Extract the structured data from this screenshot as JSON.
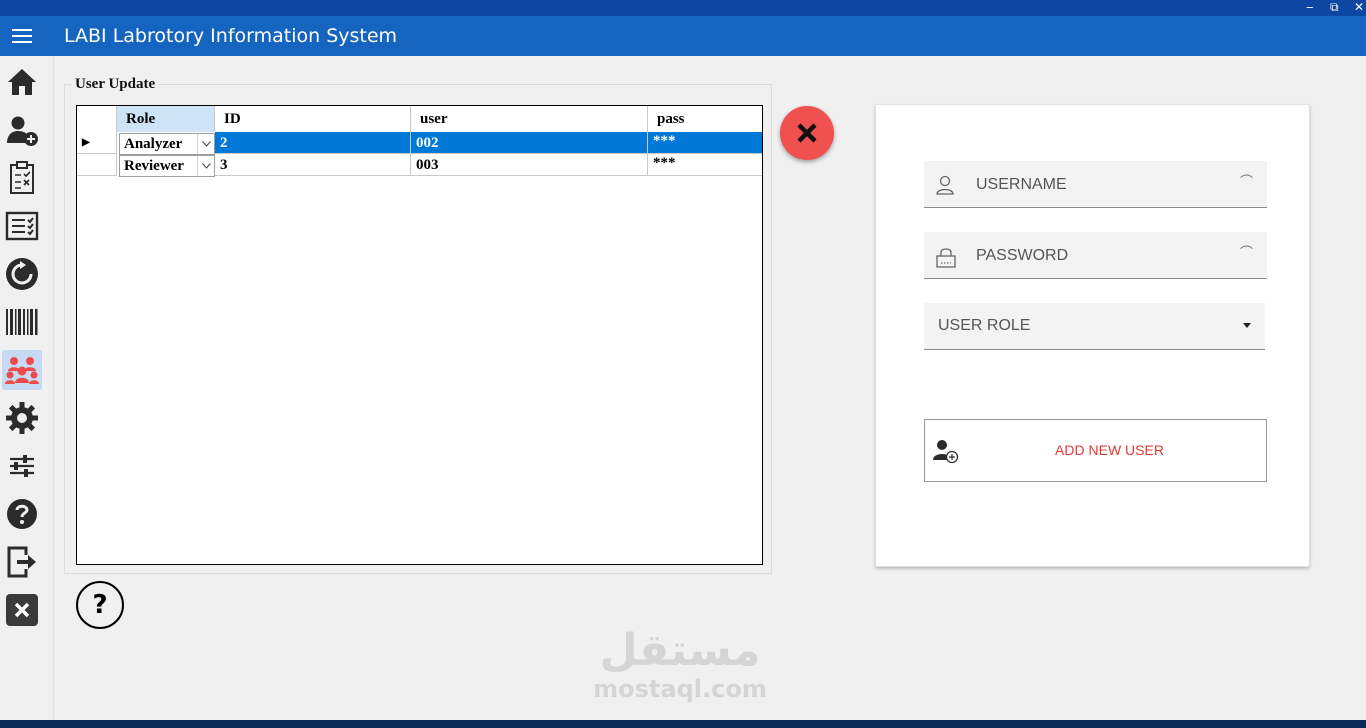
{
  "window": {
    "minimize_label": "‒",
    "restore_label": "⧉",
    "close_label": "✕"
  },
  "app": {
    "title": "LABI Labrotory Information System"
  },
  "sidebar": {
    "items": [
      {
        "name": "home-icon",
        "active": false
      },
      {
        "name": "add-patient-icon",
        "active": false
      },
      {
        "name": "test-checklist-icon",
        "active": false
      },
      {
        "name": "results-list-icon",
        "active": false
      },
      {
        "name": "refresh-icon",
        "active": false
      },
      {
        "name": "barcode-icon",
        "active": false
      },
      {
        "name": "users-group-icon",
        "active": true
      },
      {
        "name": "gear-icon",
        "active": false
      },
      {
        "name": "sliders-icon",
        "active": false
      },
      {
        "name": "help-icon",
        "active": false
      },
      {
        "name": "logout-icon",
        "active": false
      },
      {
        "name": "exit-icon",
        "active": false
      }
    ]
  },
  "user_update": {
    "title": "User Update",
    "columns": [
      "Role",
      "ID",
      "user",
      "pass"
    ],
    "rows": [
      {
        "role": "Analyzer",
        "id": "2",
        "user": "002",
        "pass": "***",
        "selected": true
      },
      {
        "role": "Reviewer",
        "id": "3",
        "user": "003",
        "pass": "***",
        "selected": false
      }
    ]
  },
  "form": {
    "username_placeholder": "USERNAME",
    "password_placeholder": "PASSWORD",
    "user_role_label": "USER ROLE",
    "add_button_label": "ADD NEW USER"
  },
  "watermark": {
    "arabic": "مستقل",
    "latin": "mostaql.com"
  },
  "colors": {
    "appbar": "#1565c0",
    "selection": "#0078d7",
    "danger": "#f05050",
    "add_label": "#e53935"
  }
}
